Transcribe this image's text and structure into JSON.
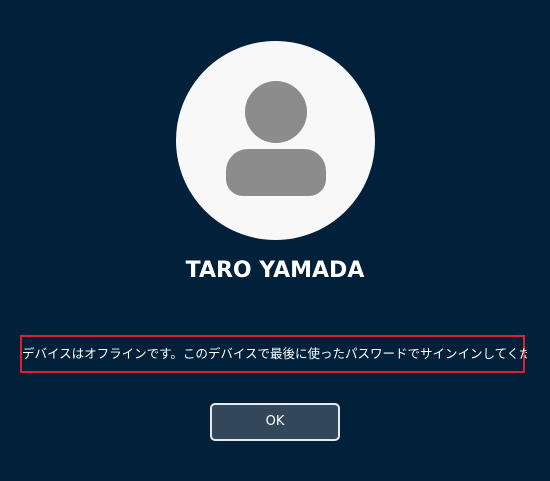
{
  "user": {
    "display_name": "TARO YAMADA"
  },
  "message": {
    "text": "デバイスはオフラインです。このデバイスで最後に使ったパスワードでサインインしてください。"
  },
  "actions": {
    "ok_label": "OK"
  },
  "colors": {
    "background": "#01203a",
    "avatar_circle": "#f9f8f9",
    "avatar_figure": "#8c8c8c",
    "highlight_border": "#e0202e",
    "button_fill": "#33475a",
    "button_border": "#e6e9ec"
  },
  "icons": {
    "avatar": "user-silhouette-icon"
  }
}
